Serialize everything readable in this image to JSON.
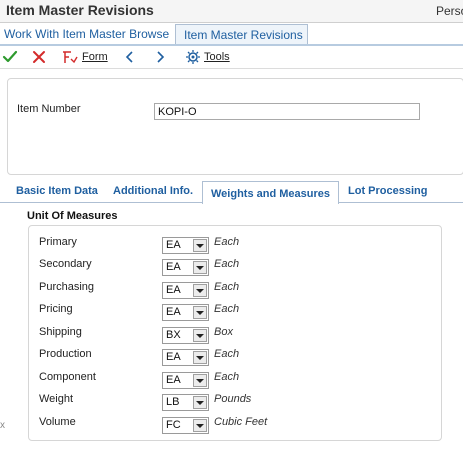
{
  "window": {
    "title": "Item Master Revisions",
    "persona_label": "Perso"
  },
  "breadcrumbs": [
    {
      "label": "Work With Item Master Browse"
    },
    {
      "label": "Item Master Revisions"
    }
  ],
  "toolbar": {
    "ok_icon": "check-icon",
    "cancel_icon": "close-icon",
    "form_label": "Form",
    "tools_label": "Tools"
  },
  "header": {
    "item_number_label": "Item Number",
    "item_number_value": "KOPI-O"
  },
  "tabs": [
    {
      "label": "Basic Item Data"
    },
    {
      "label": "Additional Info."
    },
    {
      "label": "Weights and Measures",
      "selected": true
    },
    {
      "label": "Lot Processing"
    }
  ],
  "uom": {
    "title": "Unit Of Measures",
    "rows": [
      {
        "label": "Primary",
        "value": "EA",
        "description": "Each"
      },
      {
        "label": "Secondary",
        "value": "EA",
        "description": "Each"
      },
      {
        "label": "Purchasing",
        "value": "EA",
        "description": "Each"
      },
      {
        "label": "Pricing",
        "value": "EA",
        "description": "Each"
      },
      {
        "label": "Shipping",
        "value": "BX",
        "description": "Box"
      },
      {
        "label": "Production",
        "value": "EA",
        "description": "Each"
      },
      {
        "label": "Component",
        "value": "EA",
        "description": "Each"
      },
      {
        "label": "Weight",
        "value": "LB",
        "description": "Pounds"
      },
      {
        "label": "Volume",
        "value": "FC",
        "description": "Cubic Feet"
      }
    ]
  },
  "colors": {
    "link": "#1f5fa0",
    "ok_green": "#2e9a2e",
    "cancel_red": "#d42b2b"
  }
}
